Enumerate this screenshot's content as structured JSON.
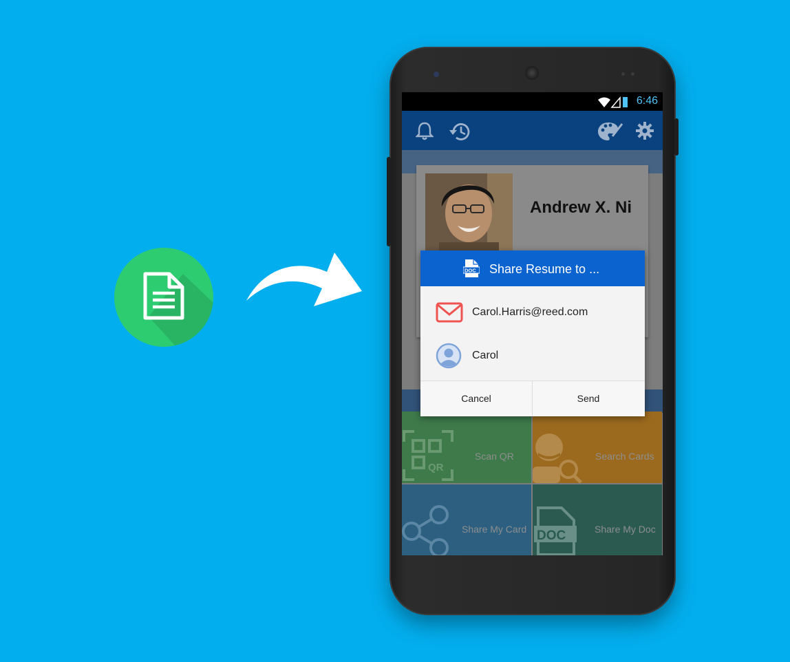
{
  "status": {
    "time": "6:46"
  },
  "profile": {
    "name": "Andrew X. Ni"
  },
  "dialog": {
    "title": "Share Resume to ...",
    "icon": "doc-file-icon",
    "recipients": [
      {
        "label": "Carol.Harris@reed.com",
        "icon": "mail-icon"
      },
      {
        "label": "Carol",
        "icon": "contact-avatar-icon"
      }
    ],
    "cancel_label": "Cancel",
    "send_label": "Send"
  },
  "tiles": [
    {
      "label": "Scan QR",
      "icon": "qr-scan-icon",
      "color": "#3e7a4a"
    },
    {
      "label": "Search Cards",
      "icon": "search-person-icon",
      "color": "#9b6a1e"
    },
    {
      "label": "Share My Card",
      "icon": "share-icon",
      "color": "#2c5f80"
    },
    {
      "label": "Share My Doc",
      "icon": "doc-file-icon",
      "color": "#2a5a50"
    }
  ],
  "colors": {
    "background": "#03aeee",
    "doc_circle": "#2ecc71",
    "dialog_header": "#0a63cf",
    "appbar": "#0a4280"
  }
}
